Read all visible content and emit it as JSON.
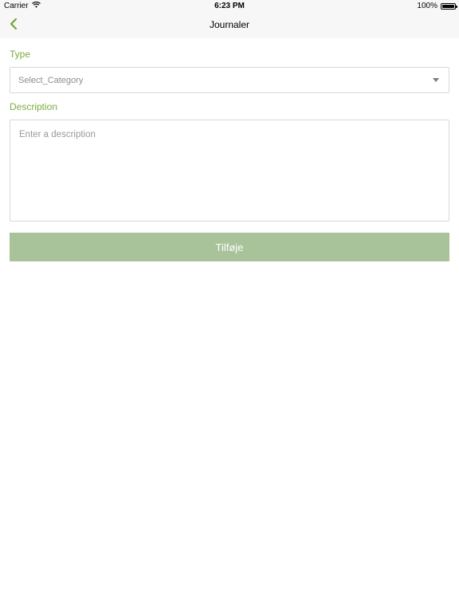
{
  "status_bar": {
    "carrier": "Carrier",
    "time": "6:23 PM",
    "battery": "100%",
    "wifi_icon": "wifi-icon",
    "battery_icon": "battery-icon",
    "battery_level": 1.0
  },
  "nav": {
    "title": "Journaler",
    "back_icon": "chevron-left-icon"
  },
  "form": {
    "type_label": "Type",
    "category_value": "Select_Category",
    "dropdown_icon": "caret-down-icon",
    "description_label": "Description",
    "description_placeholder": "Enter a description",
    "description_value": "",
    "submit_label": "Tilføje"
  },
  "colors": {
    "accent": "#7cab3f",
    "button": "#a8c399",
    "nav_background": "#f7f7f8"
  }
}
